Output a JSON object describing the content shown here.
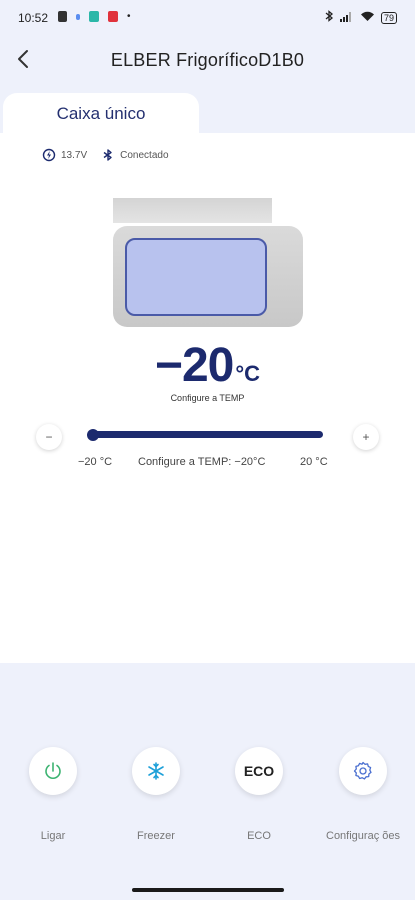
{
  "status_bar": {
    "time": "10:52",
    "battery": "79"
  },
  "header": {
    "title": "ELBER FrigoríficoD1B0"
  },
  "tabs": [
    {
      "label": "Caixa único",
      "active": true
    }
  ],
  "info": {
    "voltage": "13.7V",
    "connection": "Conectado"
  },
  "temperature": {
    "value": "−20",
    "unit": "°C",
    "caption": "Configure a TEMP"
  },
  "slider": {
    "minus_label": "−",
    "plus_label": "+",
    "min_label": "−20 °C",
    "current_label": "Configure a TEMP: −20°C",
    "max_label": "20 °C",
    "value": -20,
    "min": -20,
    "max": 20
  },
  "actions": [
    {
      "label": "Ligar",
      "icon": "power-icon"
    },
    {
      "label": "Freezer",
      "icon": "snowflake-icon"
    },
    {
      "label": "ECO",
      "icon": "eco-icon",
      "icon_text": "ECO"
    },
    {
      "label": "Configuraç ões",
      "icon": "gear-icon"
    }
  ],
  "colors": {
    "accent": "#1c2a6e",
    "background": "#eef1fb",
    "power_green": "#3cb371",
    "snow_blue": "#1ea0d8"
  }
}
